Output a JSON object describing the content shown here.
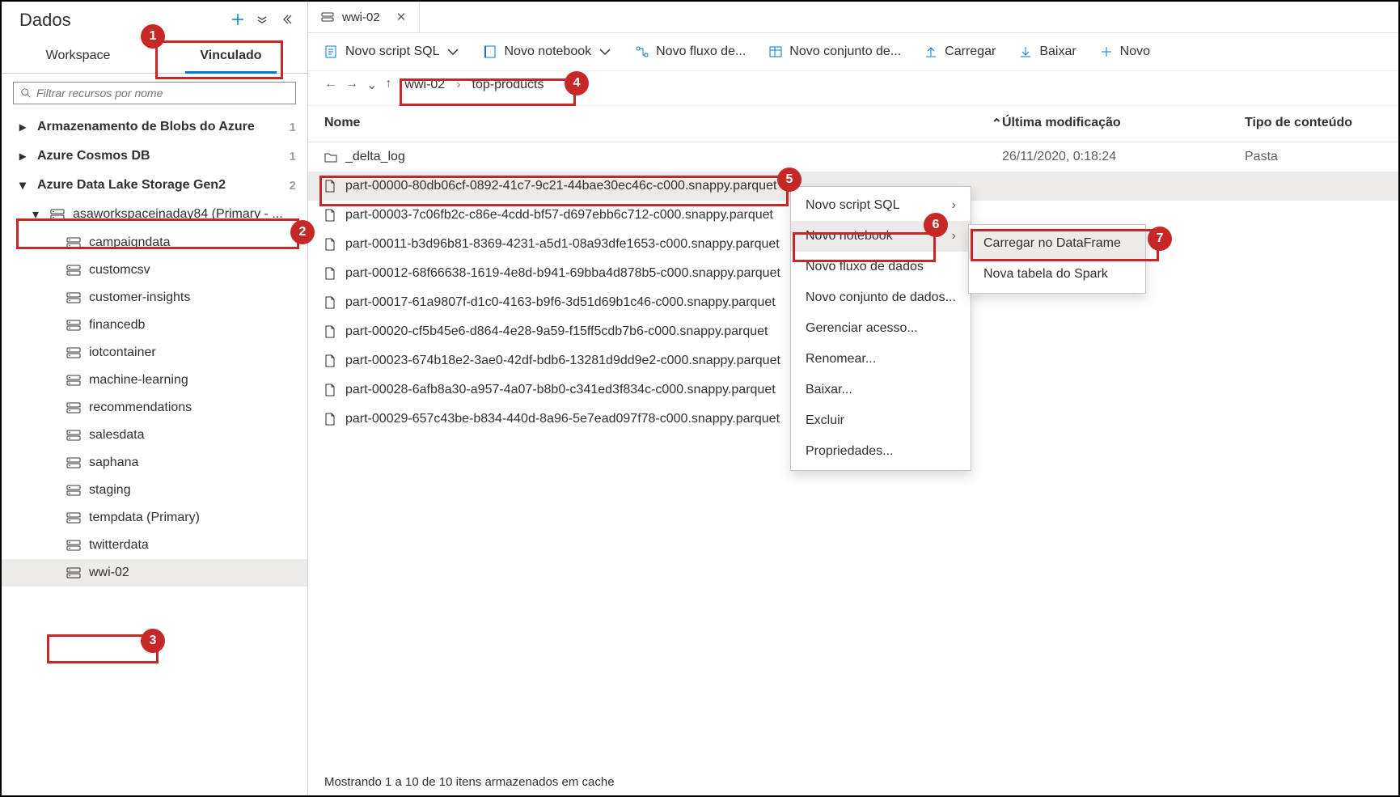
{
  "sidebar": {
    "title": "Dados",
    "tabs": {
      "workspace": "Workspace",
      "linked": "Vinculado"
    },
    "search_placeholder": "Filtrar recursos por nome",
    "groups": [
      {
        "label": "Armazenamento de Blobs do Azure",
        "count": "1",
        "expanded": false
      },
      {
        "label": "Azure Cosmos DB",
        "count": "1",
        "expanded": false
      },
      {
        "label": "Azure Data Lake Storage Gen2",
        "count": "2",
        "expanded": true
      }
    ],
    "storage_account": "asaworkspaceinaday84 (Primary - ...",
    "containers": [
      "campaigndata",
      "customcsv",
      "customer-insights",
      "financedb",
      "iotcontainer",
      "machine-learning",
      "recommendations",
      "salesdata",
      "saphana",
      "staging",
      "tempdata (Primary)",
      "twitterdata",
      "wwi-02"
    ],
    "selected_container_index": 12
  },
  "doc_tab": {
    "label": "wwi-02"
  },
  "toolbar": {
    "new_sql": "Novo script SQL",
    "new_notebook": "Novo notebook",
    "new_flow": "Novo fluxo de...",
    "new_dataset": "Novo conjunto de...",
    "upload": "Carregar",
    "download": "Baixar",
    "new": "Novo"
  },
  "breadcrumb": {
    "a": "wwi-02",
    "b": "top-products"
  },
  "columns": {
    "name": "Nome",
    "modified": "Última modificação",
    "type": "Tipo de conteúdo"
  },
  "files": [
    {
      "name": "_delta_log",
      "modified": "26/11/2020, 0:18:24",
      "type": "Pasta",
      "kind": "folder"
    },
    {
      "name": "part-00000-80db06cf-0892-41c7-9c21-44bae30ec46c-c000.snappy.parquet",
      "modified": "",
      "type": "",
      "kind": "file",
      "selected": true
    },
    {
      "name": "part-00003-7c06fb2c-c86e-4cdd-bf57-d697ebb6c712-c000.snappy.parquet",
      "modified": "",
      "type": "",
      "kind": "file"
    },
    {
      "name": "part-00011-b3d96b81-8369-4231-a5d1-08a93dfe1653-c000.snappy.parquet",
      "modified": "",
      "type": "",
      "kind": "file"
    },
    {
      "name": "part-00012-68f66638-1619-4e8d-b941-69bba4d878b5-c000.snappy.parquet",
      "modified": "",
      "type": "",
      "kind": "file"
    },
    {
      "name": "part-00017-61a9807f-d1c0-4163-b9f6-3d51d69b1c46-c000.snappy.parquet",
      "modified": "",
      "type": "",
      "kind": "file"
    },
    {
      "name": "part-00020-cf5b45e6-d864-4e28-9a59-f15ff5cdb7b6-c000.snappy.parquet",
      "modified": "",
      "type": "",
      "kind": "file"
    },
    {
      "name": "part-00023-674b18e2-3ae0-42df-bdb6-13281d9dd9e2-c000.snappy.parquet",
      "modified": "",
      "type": "",
      "kind": "file"
    },
    {
      "name": "part-00028-6afb8a30-a957-4a07-b8b0-c341ed3f834c-c000.snappy.parquet",
      "modified": "",
      "type": "",
      "kind": "file"
    },
    {
      "name": "part-00029-657c43be-b834-440d-8a96-5e7ead097f78-c000.snappy.parquet",
      "modified": "",
      "type": "",
      "kind": "file"
    }
  ],
  "context_menu": {
    "items": [
      {
        "label": "Novo script SQL",
        "sub": true
      },
      {
        "label": "Novo notebook",
        "sub": true,
        "highlight": true
      },
      {
        "label": "Novo fluxo de dados"
      },
      {
        "label": "Novo conjunto de dados..."
      },
      {
        "label": "Gerenciar acesso..."
      },
      {
        "label": "Renomear..."
      },
      {
        "label": "Baixar..."
      },
      {
        "label": "Excluir"
      },
      {
        "label": "Propriedades..."
      }
    ]
  },
  "submenu": {
    "items": [
      {
        "label": "Carregar no DataFrame",
        "highlight": true
      },
      {
        "label": "Nova tabela do Spark"
      }
    ]
  },
  "footer": "Mostrando 1 a 10 de 10 itens armazenados em cache"
}
